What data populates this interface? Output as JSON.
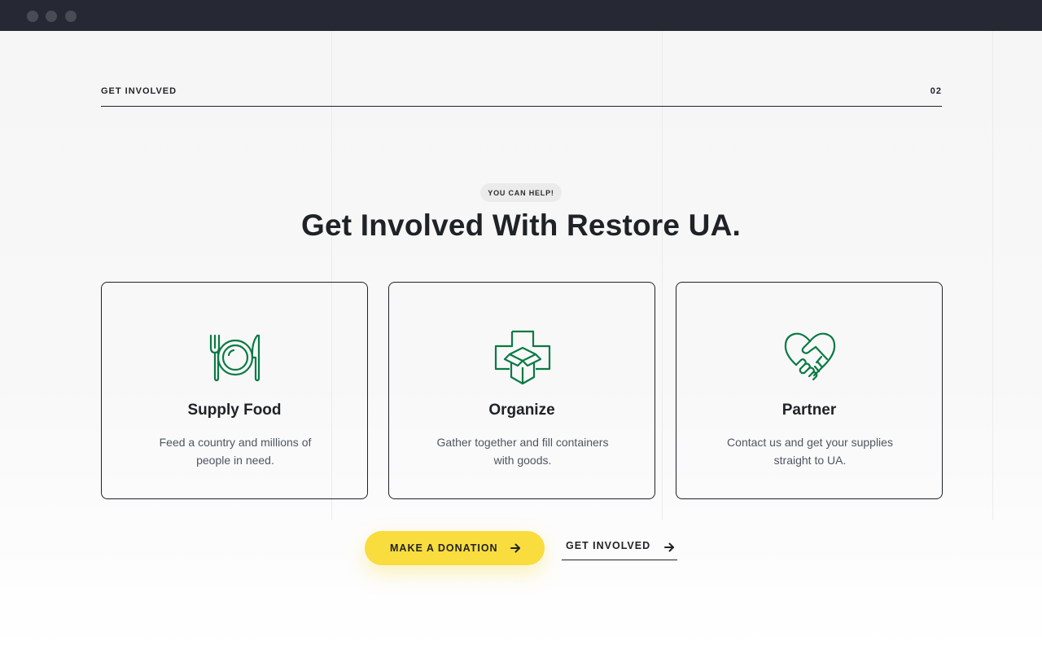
{
  "section": {
    "label": "GET INVOLVED",
    "number": "02"
  },
  "pill": "YOU CAN HELP!",
  "heading": "Get Involved With Restore UA.",
  "cards": [
    {
      "icon": "plate-cutlery-icon",
      "title": "Supply Food",
      "description": "Feed a country and millions of people in need."
    },
    {
      "icon": "medical-box-icon",
      "title": "Organize",
      "description": "Gather together and fill containers with goods."
    },
    {
      "icon": "heart-handshake-icon",
      "title": "Partner",
      "description": "Contact us and get your supplies straight to UA."
    }
  ],
  "actions": {
    "donate_label": "MAKE A DONATION",
    "involved_label": "GET INVOLVED"
  },
  "colors": {
    "accent_green": "#0a7a44",
    "button_yellow": "#f9dc3e",
    "titlebar": "#262833",
    "text_dark": "#1f2226"
  }
}
